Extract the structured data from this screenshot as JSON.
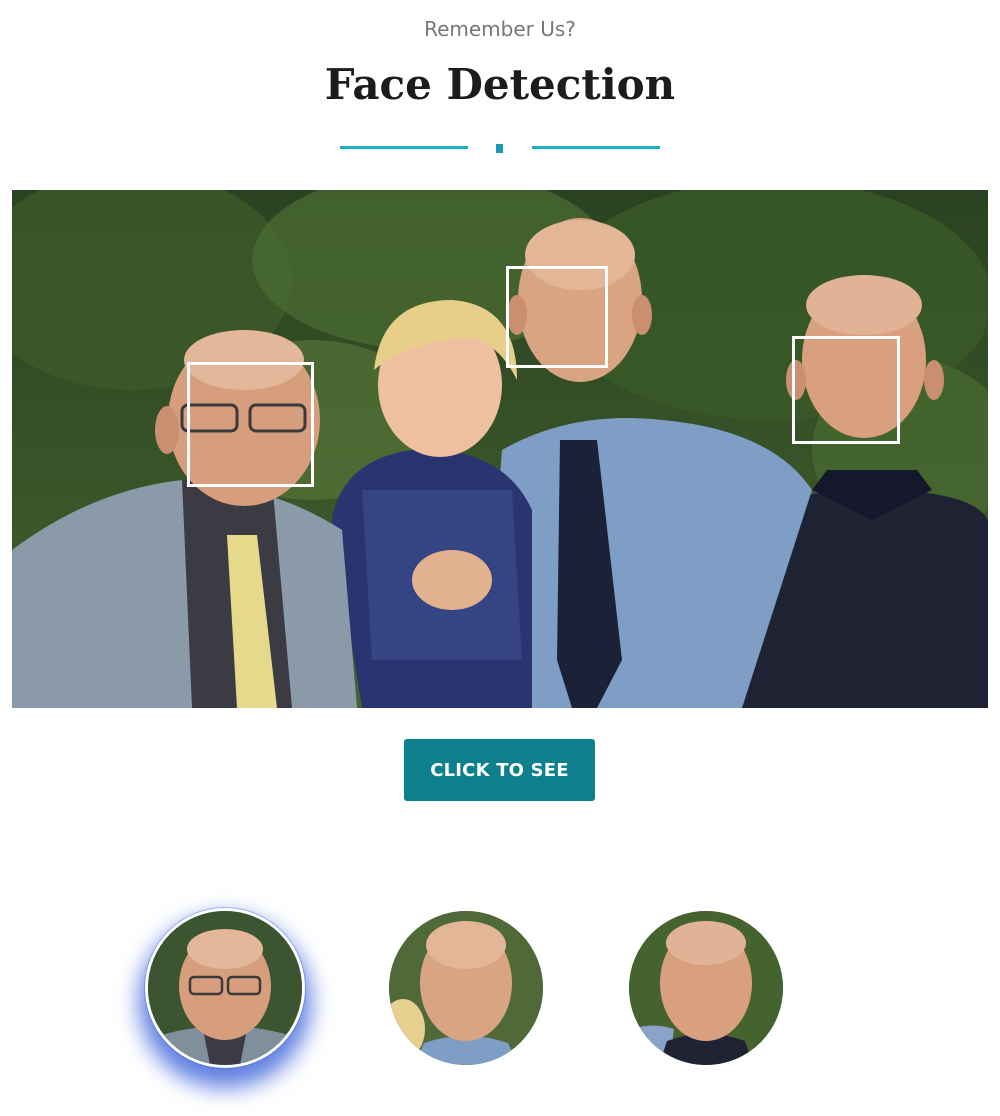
{
  "header": {
    "eyebrow": "Remember Us?",
    "title": "Face Detection"
  },
  "photo": {
    "alt": "Family group photo of four people outdoors",
    "detected_faces": [
      "face-1",
      "face-2",
      "face-3"
    ]
  },
  "cta": {
    "label": "CLICK TO SEE"
  },
  "thumbnails": {
    "items": [
      {
        "id": "face-1",
        "selected": true
      },
      {
        "id": "face-2",
        "selected": false
      },
      {
        "id": "face-3",
        "selected": false
      }
    ]
  },
  "colors": {
    "accent": "#1fb0c8",
    "button": "#0d7f8d",
    "selection_glow": "#2c56d7"
  }
}
